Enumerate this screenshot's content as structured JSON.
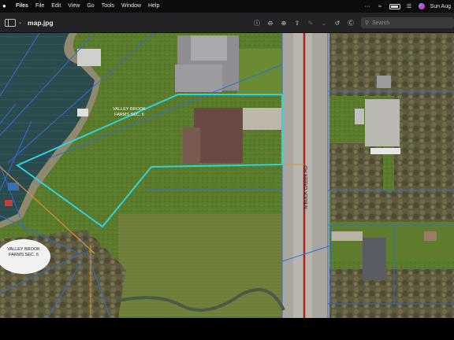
{
  "menubar": {
    "apple": "",
    "items": [
      "Files",
      "File",
      "Edit",
      "View",
      "Go",
      "Tools",
      "Window",
      "Help"
    ],
    "clock": "Sun Aug"
  },
  "toolbar": {
    "title": "map.jpg",
    "search_placeholder": "Search"
  },
  "map": {
    "road_label": "N BUCK CREEK RD",
    "subdivision_label_1_line1": "VALLEY BROOK",
    "subdivision_label_1_line2": "FARMS SEC. 6",
    "subdivision_label_2_line1": "VALLEY BROOK",
    "subdivision_label_2_line2": "FARMS SEC. 6",
    "highlight_color": "#2fd3e0",
    "parcel_line_color": "#2f6fd6",
    "road_line_color": "#b0211c"
  }
}
